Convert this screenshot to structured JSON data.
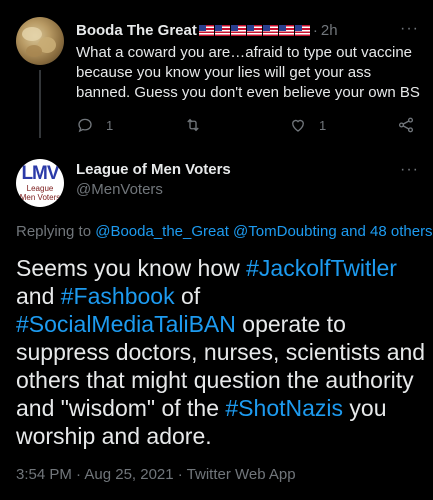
{
  "reply_tweet": {
    "author_name": "Booda The Great",
    "flag_count": 7,
    "separator": "·",
    "time": "2h",
    "more_label": "···",
    "body": "What a coward you are…afraid to type out vaccine because you know your lies will get your ass banned.  Guess you don't even believe your own BS",
    "actions": {
      "reply_count": "1",
      "retweet_count": "",
      "like_count": "1"
    }
  },
  "main_tweet": {
    "avatar_text": "LMV",
    "avatar_sub1": "League",
    "avatar_sub2": "Men Voters",
    "author_name": "League of Men Voters",
    "handle": "@MenVoters",
    "more_label": "···",
    "replying": {
      "prefix": "Replying to ",
      "user1": "@Booda_the_Great",
      "space": " ",
      "user2": "@TomDoubting",
      "suffix": " and 48 others"
    },
    "text": {
      "t1": "Seems you know how ",
      "h1": "#JackolfTwitler",
      "t2": " and ",
      "h2": "#Fashbook",
      "t3": " of ",
      "h3": "#SocialMediaTaliBAN",
      "t4": " operate to suppress doctors, nurses, scientists and others that might question the authority and \"wisdom\" of the ",
      "h4": "#ShotNazis",
      "t5": " you worship and adore."
    },
    "timestamp": "3:54 PM · Aug 25, 2021 · Twitter Web App"
  },
  "colors": {
    "background": "#000000",
    "text": "#e7e9ea",
    "muted": "#71767b",
    "link": "#1d9bf0"
  },
  "icons": [
    "reply-icon",
    "retweet-icon",
    "like-icon",
    "share-icon",
    "more-icon",
    "us-flag-icon"
  ]
}
